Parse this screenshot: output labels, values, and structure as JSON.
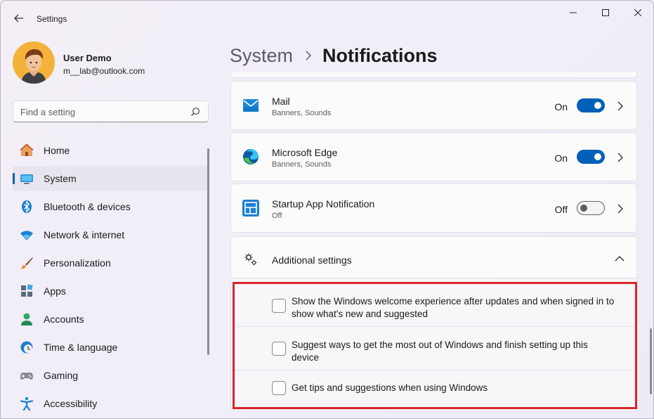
{
  "window": {
    "app_title": "Settings",
    "controls": [
      "minimize",
      "maximize",
      "close"
    ]
  },
  "user": {
    "name": "User Demo",
    "email": "m__lab@outlook.com"
  },
  "search": {
    "placeholder": "Find a setting"
  },
  "nav": {
    "items": [
      {
        "label": "Home",
        "icon": "home-icon"
      },
      {
        "label": "System",
        "icon": "system-icon",
        "active": true
      },
      {
        "label": "Bluetooth & devices",
        "icon": "bluetooth-icon"
      },
      {
        "label": "Network & internet",
        "icon": "wifi-icon"
      },
      {
        "label": "Personalization",
        "icon": "brush-icon"
      },
      {
        "label": "Apps",
        "icon": "apps-icon"
      },
      {
        "label": "Accounts",
        "icon": "accounts-icon"
      },
      {
        "label": "Time & language",
        "icon": "clock-globe-icon"
      },
      {
        "label": "Gaming",
        "icon": "gamepad-icon"
      },
      {
        "label": "Accessibility",
        "icon": "accessibility-icon"
      }
    ]
  },
  "breadcrumb": {
    "parent": "System",
    "current": "Notifications"
  },
  "apps": [
    {
      "name": "Mail",
      "sub": "Banners, Sounds",
      "state": "On",
      "icon": "mail-icon"
    },
    {
      "name": "Microsoft Edge",
      "sub": "Banners, Sounds",
      "state": "On",
      "icon": "edge-icon"
    },
    {
      "name": "Startup App Notification",
      "sub": "Off",
      "state": "Off",
      "icon": "startup-app-icon"
    }
  ],
  "additional": {
    "label": "Additional settings",
    "options": [
      {
        "text": "Show the Windows welcome experience after updates and when signed in to show what's new and suggested",
        "checked": false
      },
      {
        "text": "Suggest ways to get the most out of Windows and finish setting up this device",
        "checked": false
      },
      {
        "text": "Get tips and suggestions when using Windows",
        "checked": false
      }
    ]
  },
  "colors": {
    "accent": "#005fb8",
    "highlight_box": "#d9262a"
  }
}
